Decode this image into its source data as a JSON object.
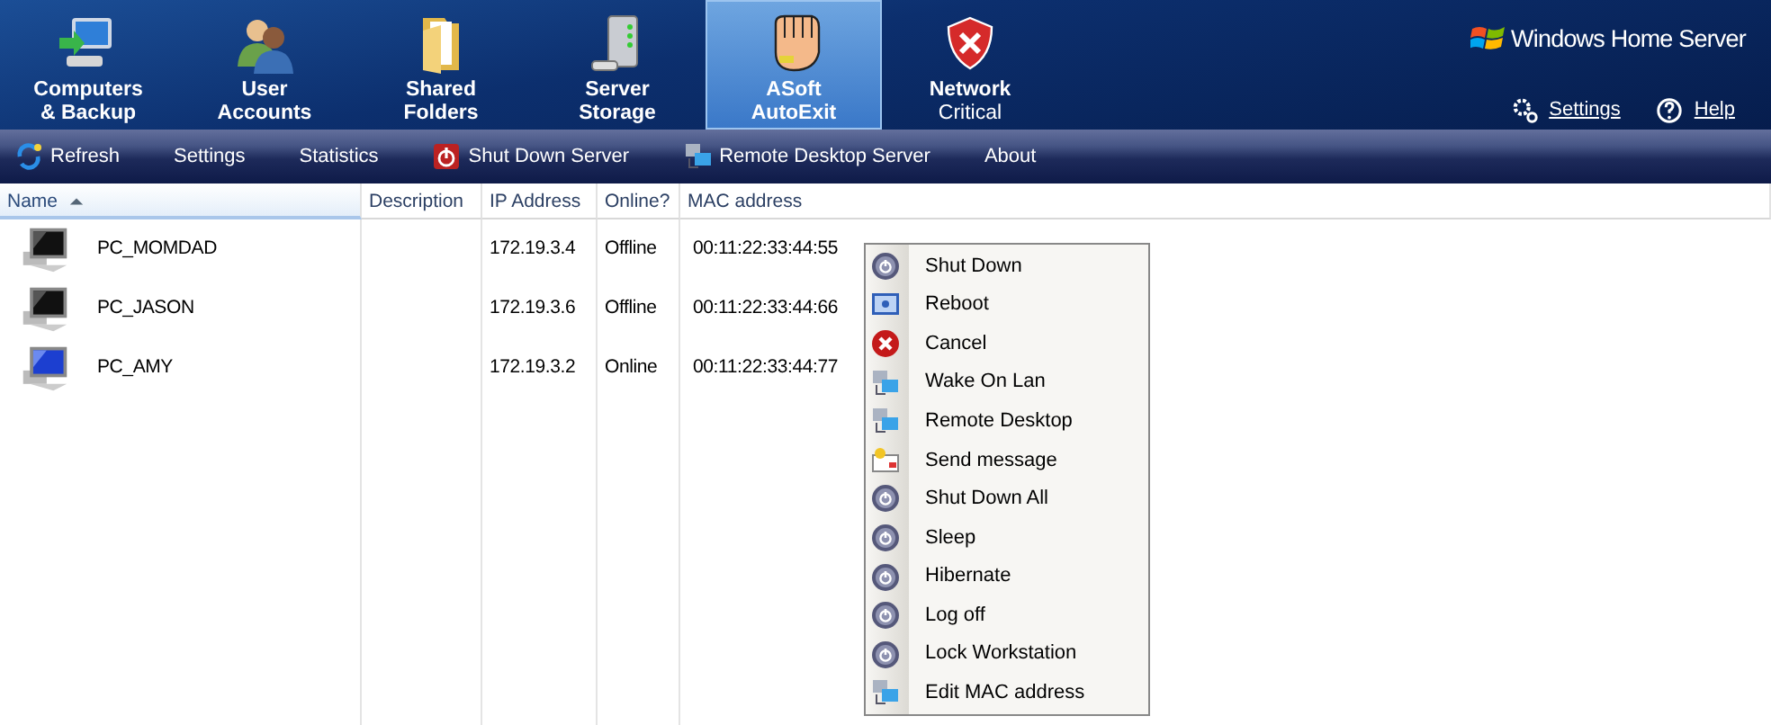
{
  "tabs": [
    {
      "label": "Computers\n& Backup",
      "selected": false
    },
    {
      "label": "User\nAccounts",
      "selected": false
    },
    {
      "label": "Shared\nFolders",
      "selected": false
    },
    {
      "label": "Server\nStorage",
      "selected": false
    },
    {
      "label": "ASoft\nAutoExit",
      "selected": true
    },
    {
      "label": "Network",
      "status": "Critical",
      "selected": false
    }
  ],
  "brand": "Windows Home Server",
  "header_links": [
    {
      "label": "Settings"
    },
    {
      "label": "Help"
    }
  ],
  "toolbar": [
    {
      "label": "Refresh"
    },
    {
      "label": "Settings"
    },
    {
      "label": "Statistics"
    },
    {
      "label": "Shut Down Server"
    },
    {
      "label": "Remote Desktop Server"
    },
    {
      "label": "About"
    }
  ],
  "table": {
    "columns": [
      {
        "label": "Name",
        "sorted": true
      },
      {
        "label": "Description",
        "sorted": false
      },
      {
        "label": "IP Address",
        "sorted": false
      },
      {
        "label": "Online?",
        "sorted": false
      },
      {
        "label": "MAC address",
        "sorted": false
      }
    ],
    "rows": [
      {
        "name": "PC_MOMDAD",
        "ip": "172.19.3.4",
        "online": "Offline",
        "mac": "00:11:22:33:44:55",
        "screen_on": false
      },
      {
        "name": "PC_JASON",
        "ip": "172.19.3.6",
        "online": "Offline",
        "mac": "00:11:22:33:44:66",
        "screen_on": false
      },
      {
        "name": "PC_AMY",
        "ip": "172.19.3.2",
        "online": "Online",
        "mac": "00:11:22:33:44:77",
        "screen_on": true
      }
    ]
  },
  "context_menu": [
    {
      "label": "Shut Down",
      "kind": "power"
    },
    {
      "label": "Reboot",
      "kind": "reboot"
    },
    {
      "label": "Cancel",
      "kind": "cancel"
    },
    {
      "label": "Wake On Lan",
      "kind": "network"
    },
    {
      "label": "Remote Desktop",
      "kind": "network"
    },
    {
      "label": "Send message",
      "kind": "message"
    },
    {
      "label": "Shut Down All",
      "kind": "power"
    },
    {
      "label": "Sleep",
      "kind": "power"
    },
    {
      "label": "Hibernate",
      "kind": "power"
    },
    {
      "label": "Log off",
      "kind": "power"
    },
    {
      "label": "Lock Workstation",
      "kind": "power"
    },
    {
      "label": "Edit MAC address",
      "kind": "network"
    }
  ]
}
